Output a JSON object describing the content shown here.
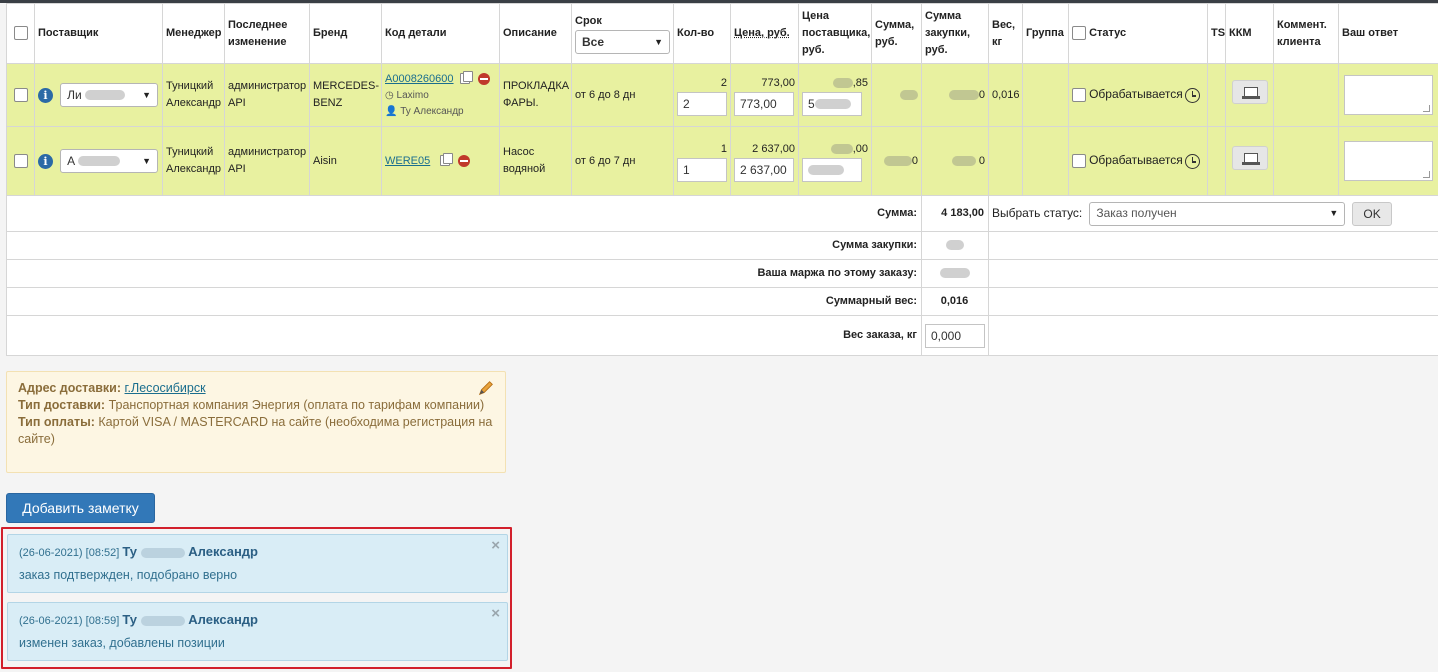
{
  "header": {
    "supplier": "Поставщик",
    "manager": "Менеджер",
    "last_change": "Последнее изменение",
    "brand": "Бренд",
    "part_code": "Код детали",
    "description": "Описание",
    "term": "Срок",
    "term_filter": "Все",
    "qty": "Кол-во",
    "price": "Цена, руб.",
    "supplier_price": "Цена поставщика, руб.",
    "sum": "Сумма, руб.",
    "purchase_sum": "Сумма закупки, руб.",
    "weight": "Вес, кг",
    "group": "Группа",
    "status": "Статус",
    "ts": "TS",
    "kkm": "ККМ",
    "client_comment": "Коммент. клиента",
    "your_answer": "Ваш ответ"
  },
  "rows": [
    {
      "supplier": "Ли",
      "manager": "Туницкий Александр",
      "last_change": "администратор API",
      "brand": "MERCEDES-BENZ",
      "code": "A0008260600",
      "source": "Laximo",
      "person": "Ту Александр",
      "description": "ПРОКЛАДКА ФАРЫ.",
      "term": "от 6 до 8 дн",
      "qty_label": "2",
      "qty_value": "2",
      "price_label": "773,00",
      "price_value": "773,00",
      "supplier_price": ",85",
      "supplier_price_input": "5",
      "sum": "",
      "purchase_sum": "0",
      "weight": "0,016",
      "status": "Обрабатывается"
    },
    {
      "supplier": "А",
      "manager": "Туницкий Александр",
      "last_change": "администратор API",
      "brand": "Aisin",
      "code": "WERE05",
      "description": "Насос водяной",
      "term": "от 6 до 7 дн",
      "qty_label": "1",
      "qty_value": "1",
      "price_label": "2 637,00",
      "price_value": "2 637,00",
      "supplier_price": ",00",
      "supplier_price_input": "",
      "sum": "0",
      "purchase_sum": "0",
      "weight": "",
      "status": "Обрабатывается"
    }
  ],
  "summary": {
    "sum_label": "Сумма:",
    "sum_value": "4 183,00",
    "choose_status_label": "Выбрать статус:",
    "choose_status_value": "Заказ получен",
    "ok_label": "OK",
    "purchase_label": "Сумма закупки:",
    "margin_label": "Ваша маржа по этому заказу:",
    "total_weight_label": "Суммарный вес:",
    "total_weight_value": "0,016",
    "order_weight_label": "Вес заказа, кг",
    "order_weight_value": "0,000"
  },
  "delivery": {
    "address_label": "Адрес доставки:",
    "address_value": "г.Лесосибирск",
    "type_label": "Тип доставки:",
    "type_value": "Транспортная компания Энергия (оплата по тарифам компании)",
    "payment_label": "Тип оплаты:",
    "payment_value": "Картой VISA / MASTERCARD на сайте (необходима регистрация на сайте)"
  },
  "add_note_label": "Добавить заметку",
  "notes": [
    {
      "stamp": "(26-06-2021) [08:52]",
      "author_first": "Ту",
      "author_last": "Александр",
      "text": "заказ подтвержден, подобрано верно",
      "close": "×"
    },
    {
      "stamp": "(26-06-2021) [08:59]",
      "author_first": "Ту",
      "author_last": "Александр",
      "text": "изменен заказ, добавлены позиции",
      "close": "×"
    }
  ],
  "colors": {
    "row_bg": "#e8f1a0",
    "primary_button": "#3278b8",
    "notes_frame": "#d21f2b",
    "note_bg": "#d9edf6",
    "delivery_bg": "#fdf6e3"
  }
}
